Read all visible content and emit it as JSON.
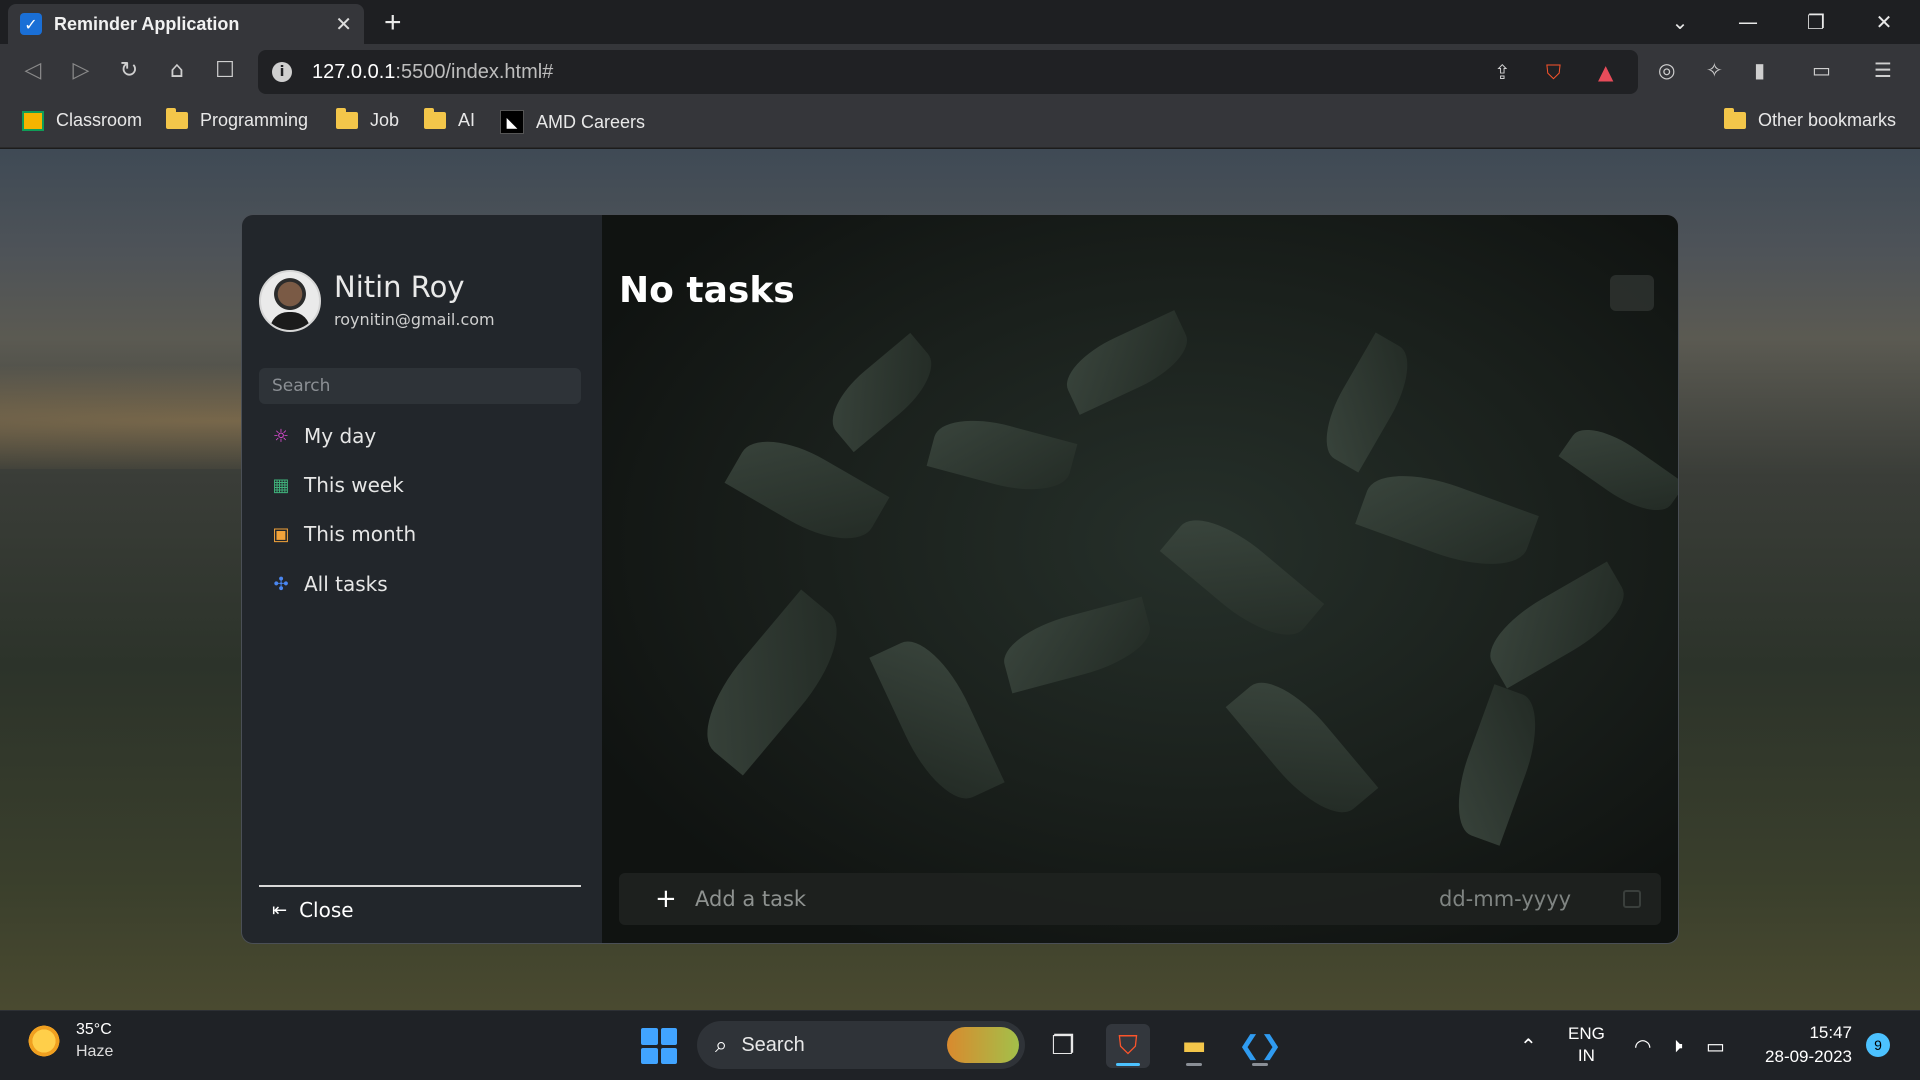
{
  "browser": {
    "tab_title": "Reminder Application",
    "url_host": "127.0.0.1",
    "url_rest": ":5500/index.html#",
    "bookmarks": {
      "classroom": "Classroom",
      "programming": "Programming",
      "job": "Job",
      "ai": "AI",
      "amd": "AMD Careers",
      "other": "Other bookmarks"
    }
  },
  "sidebar": {
    "user_name": "Nitin Roy",
    "user_email": "roynitin@gmail.com",
    "search_placeholder": "Search",
    "items": [
      {
        "label": "My day",
        "icon": "sun-icon",
        "color": "#e04bd6"
      },
      {
        "label": "This week",
        "icon": "grid-icon",
        "color": "#3fb07a"
      },
      {
        "label": "This month",
        "icon": "calendar-icon",
        "color": "#f2a33a"
      },
      {
        "label": "All tasks",
        "icon": "puzzle-icon",
        "color": "#4a86f0"
      }
    ],
    "close_label": "Close"
  },
  "main": {
    "title": "No tasks",
    "add_placeholder": "Add a task",
    "date_placeholder": "dd-mm-yyyy"
  },
  "taskbar": {
    "temperature": "35°C",
    "condition": "Haze",
    "search_label": "Search",
    "lang_primary": "ENG",
    "lang_secondary": "IN",
    "time": "15:47",
    "date": "28-09-2023",
    "notifications": "9"
  }
}
